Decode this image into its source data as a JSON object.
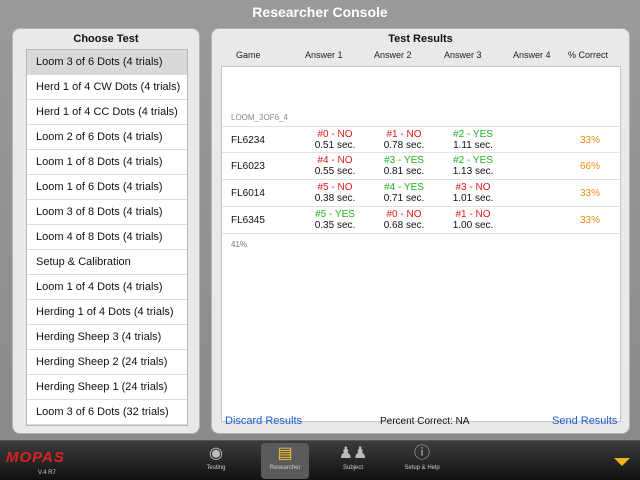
{
  "title": "Researcher Console",
  "choose": {
    "title": "Choose Test",
    "selected_index": 0,
    "items": [
      "Loom 3 of 6 Dots (4 trials)",
      "Herd 1 of 4 CW Dots (4 trials)",
      "Herd 1 of 4 CC Dots (4 trials)",
      "Loom 2 of 6 Dots (4 trials)",
      "Loom 1 of 8 Dots (4 trials)",
      "Loom 1 of 6 Dots (4 trials)",
      "Loom 3 of 8 Dots (4 trials)",
      "Loom 4 of 8 Dots (4 trials)",
      "Setup & Calibration",
      "Loom 1 of 4 Dots (4 trials)",
      "Herding 1 of 4 Dots (4 trials)",
      "Herding Sheep 3 (4 trials)",
      "Herding Sheep 2 (24 trials)",
      "Herding Sheep 1 (24 trials)",
      "Loom 3 of 6 Dots (32 trials)"
    ]
  },
  "results": {
    "title": "Test Results",
    "columns": [
      "Game",
      "Answer 1",
      "Answer 2",
      "Answer 3",
      "Answer 4",
      "% Correct"
    ],
    "section": "LOOM_3OF6_4",
    "rows": [
      {
        "game": "FL6234",
        "answers": [
          {
            "result": "#0 - NO",
            "correct": false,
            "time": "0.51 sec."
          },
          {
            "result": "#1 - NO",
            "correct": false,
            "time": "0.78 sec."
          },
          {
            "result": "#2 - YES",
            "correct": true,
            "time": "1.11 sec."
          }
        ],
        "pct": "33%"
      },
      {
        "game": "FL6023",
        "answers": [
          {
            "result": "#4 - NO",
            "correct": false,
            "time": "0.55 sec."
          },
          {
            "result": "#3 - YES",
            "correct": true,
            "time": "0.81 sec."
          },
          {
            "result": "#2 - YES",
            "correct": true,
            "time": "1.13 sec."
          }
        ],
        "pct": "66%"
      },
      {
        "game": "FL6014",
        "answers": [
          {
            "result": "#5 - NO",
            "correct": false,
            "time": "0.38 sec."
          },
          {
            "result": "#4 - YES",
            "correct": true,
            "time": "0.71 sec."
          },
          {
            "result": "#3 - NO",
            "correct": false,
            "time": "1.01 sec."
          }
        ],
        "pct": "33%"
      },
      {
        "game": "FL6345",
        "answers": [
          {
            "result": "#5 - YES",
            "correct": true,
            "time": "0.35 sec."
          },
          {
            "result": "#0 - NO",
            "correct": false,
            "time": "0.68 sec."
          },
          {
            "result": "#1 - NO",
            "correct": false,
            "time": "1.00 sec."
          }
        ],
        "pct": "33%"
      }
    ],
    "total": "41%",
    "discard_label": "Discard Results",
    "percent_label": "Percent Correct: NA",
    "send_label": "Send Results"
  },
  "tabbar": {
    "logo": "MOPAS",
    "version": "V.4 R7",
    "tabs": [
      {
        "label": "Testing",
        "icon": "eye-icon",
        "active": false
      },
      {
        "label": "Researcher",
        "icon": "clipboard-icon",
        "active": true
      },
      {
        "label": "Subject",
        "icon": "people-icon",
        "active": false
      },
      {
        "label": "Setup & Help",
        "icon": "info-icon",
        "active": false
      }
    ]
  },
  "colors": {
    "no": "#e11a1a",
    "yes": "#1db51d",
    "percent": "#ee8a10",
    "link": "#1a5ed8",
    "active_icon": "#f2c230"
  }
}
